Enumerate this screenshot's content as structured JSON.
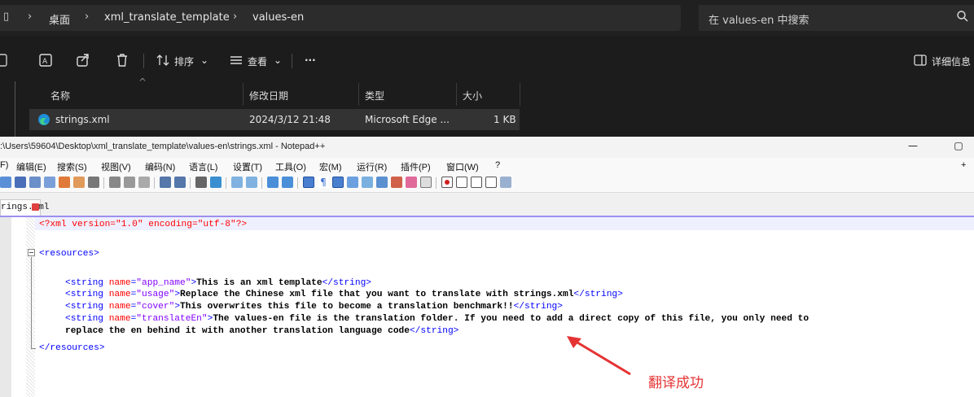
{
  "explorer": {
    "breadcrumb": [
      "桌面",
      "xml_translate_template",
      "values-en"
    ],
    "search_placeholder": "在 values-en 中搜索",
    "toolbar": {
      "sort_label": "排序",
      "view_label": "查看",
      "more_label": "···",
      "details_label": "详细信息"
    },
    "columns": [
      "名称",
      "修改日期",
      "类型",
      "大小"
    ],
    "file": {
      "name": "strings.xml",
      "modified": "2024/3/12 21:48",
      "type": "Microsoft Edge ...",
      "size": "1 KB"
    }
  },
  "notepad": {
    "title": ":\\Users\\59604\\Desktop\\xml_translate_template\\values-en\\strings.xml - Notepad++",
    "menu": [
      "F)",
      "编辑(E)",
      "搜索(S)",
      "视图(V)",
      "编码(N)",
      "语言(L)",
      "设置(T)",
      "工具(O)",
      "宏(M)",
      "运行(R)",
      "插件(P)",
      "窗口(W)",
      "?"
    ],
    "menu_plus": "+",
    "tab_label": "rings.xml",
    "code": {
      "xml_decl": "<?xml version=\"1.0\" encoding=\"utf-8\"?>",
      "open_resources": "<resources>",
      "strings": [
        {
          "name": "app_name",
          "text": "This is an xml template"
        },
        {
          "name": "usage",
          "text": "Replace the Chinese xml file that you want to translate with strings.xml"
        },
        {
          "name": "cover",
          "text": "This overwrites this file to become a translation benchmark!!"
        },
        {
          "name": "translateEn",
          "text": "The values-en file is the translation folder. If you need to add a direct copy of this file, you only need to",
          "text_cont": "replace the en behind it with another translation language code"
        }
      ],
      "close_resources": "</resources>"
    }
  },
  "annotation": {
    "text": "翻译成功",
    "color": "#e53333"
  }
}
